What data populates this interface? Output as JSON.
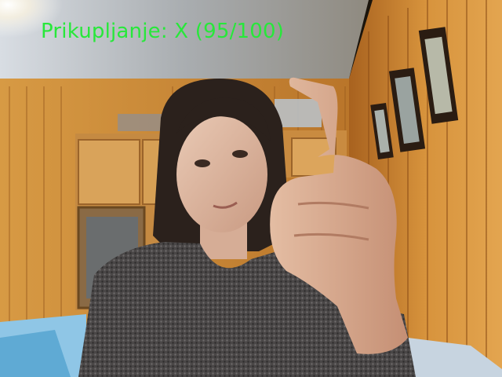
{
  "overlay": {
    "caption": "Prikupljanje: X (95/100)",
    "caption_color": "#27e83a"
  },
  "camera_feed": {
    "description_icon": "webcam-frame",
    "collected_count": 95,
    "total_count": 100,
    "gesture_label": "X"
  }
}
